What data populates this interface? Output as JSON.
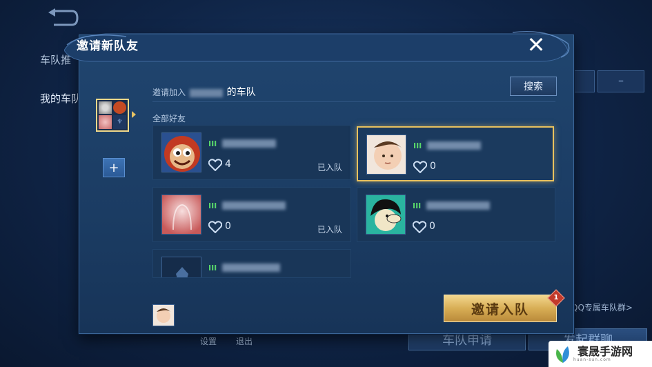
{
  "background": {
    "tabs": [
      "车队推",
      "我的车队"
    ],
    "footer_links": [
      "设置",
      "退出"
    ],
    "team_apply_button": "车队申请",
    "start_chat_button": "发起群聊",
    "qq_group_link": "QQ专属车队群>"
  },
  "dialog": {
    "title": "邀请新队友",
    "close_icon": "close-x-icon",
    "invite_prefix": "邀请加入",
    "invite_suffix": "的车队",
    "search_label": "搜索",
    "section_label": "全部好友",
    "add_label": "+",
    "invite_button_label": "邀请入队",
    "invite_badge_count": "1"
  },
  "friends": [
    {
      "avatar": "monkey-avatar",
      "rank": "III",
      "likes": "4",
      "status": "已入队"
    },
    {
      "avatar": "baby-photo-avatar",
      "rank": "III",
      "likes": "0",
      "status": ""
    },
    {
      "avatar": "ghost-pink-avatar",
      "rank": "III",
      "likes": "0",
      "status": "已入队"
    },
    {
      "avatar": "cartoon-face-avatar",
      "rank": "III",
      "likes": "0",
      "status": ""
    },
    {
      "avatar": "default-hero-avatar",
      "rank": "III",
      "likes": "",
      "status": ""
    }
  ],
  "watermark": {
    "text": "寰晟手游网",
    "sub": "huan-sun.com"
  },
  "colors": {
    "accent_gold": "#e9c25e",
    "rank_green": "#58d66a",
    "badge_red": "#c23a2b"
  }
}
